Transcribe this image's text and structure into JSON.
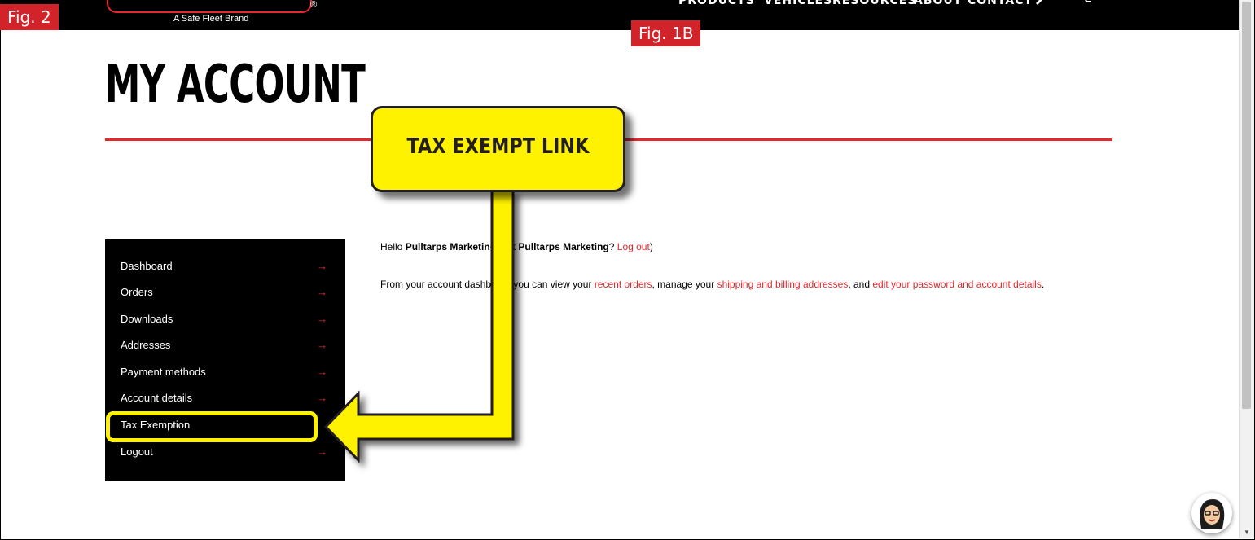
{
  "header": {
    "brand_reg": "®",
    "tagline": "A Safe Fleet Brand",
    "nav": [
      "PRODUCTS",
      "VEHICLES",
      "RESOURCES",
      "ABOUT",
      "CONTACT"
    ],
    "icons": [
      "user-icon",
      "cart-icon"
    ]
  },
  "figure_labels": {
    "fig2": "Fig. 2",
    "fig1b": "Fig. 1B"
  },
  "page": {
    "title": "MY ACCOUNT"
  },
  "sidebar": {
    "items": [
      {
        "label": "Dashboard"
      },
      {
        "label": "Orders"
      },
      {
        "label": "Downloads"
      },
      {
        "label": "Addresses"
      },
      {
        "label": "Payment methods"
      },
      {
        "label": "Account details"
      },
      {
        "label": "Tax Exemption"
      },
      {
        "label": "Logout"
      }
    ],
    "arrow": "→"
  },
  "content": {
    "hello_prefix": "Hello ",
    "user_name": "Pulltarps Marketing",
    "not_text": " (not ",
    "not_user": "Pulltarps Marketing",
    "q_text": "? ",
    "logout_link": "Log out",
    "close_paren": ")",
    "dash_prefix": "From your account dashboard you can view your ",
    "recent_orders_link": "recent orders",
    "manage_text": ", manage your ",
    "addresses_link": "shipping and billing addresses",
    "and_text": ", and ",
    "password_link": "edit your password and account details",
    "period": "."
  },
  "callout": {
    "text": "TAX EXEMPT LINK"
  },
  "colors": {
    "accent": "#e5282d",
    "callout_yellow": "#fff200",
    "header_bg": "#000000",
    "figure_label_bg": "#d2232a"
  }
}
